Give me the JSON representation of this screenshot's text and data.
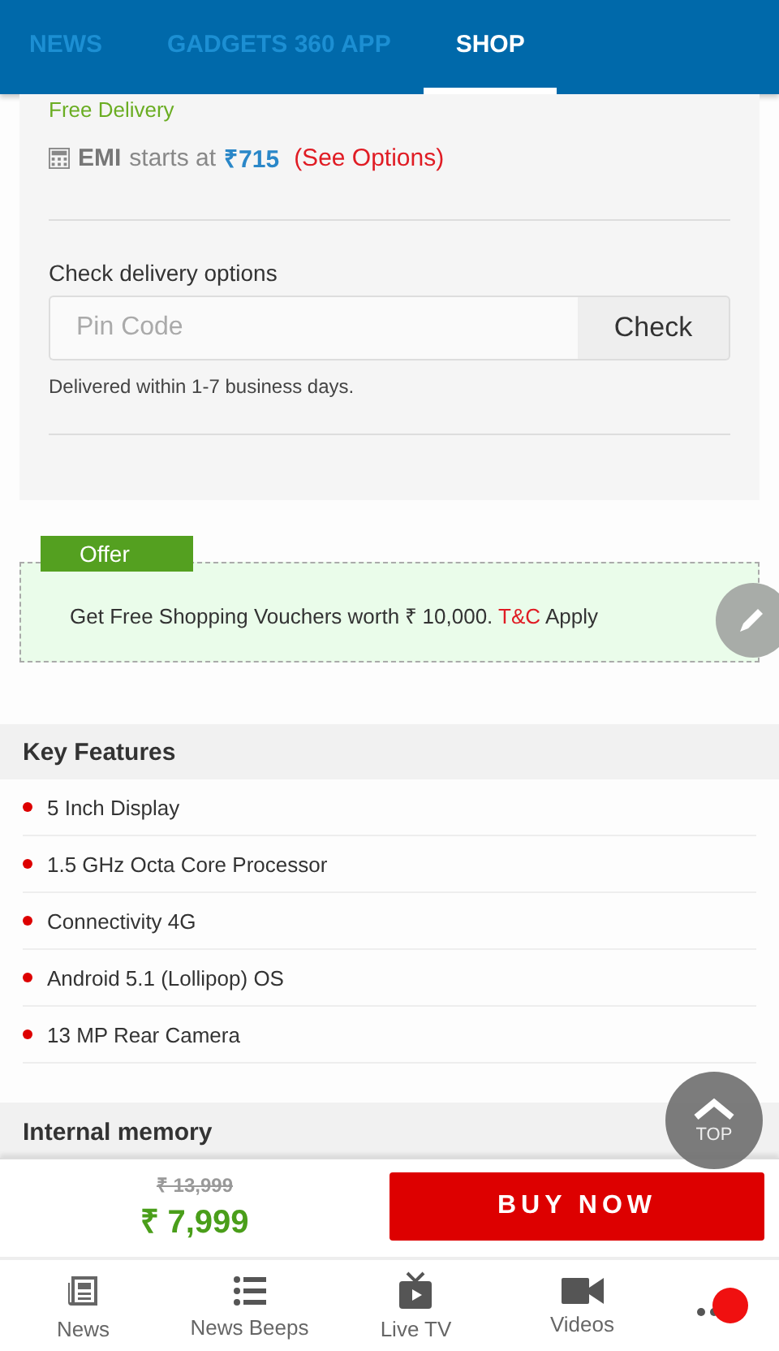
{
  "tabs": [
    {
      "label": "NEWS",
      "selected": false
    },
    {
      "label": "GADGETS 360 APP",
      "selected": false
    },
    {
      "label": "SHOP",
      "selected": true
    }
  ],
  "delivery_note": "Free Delivery",
  "emi": {
    "label": "EMI",
    "text": "starts at",
    "amount": "₹715",
    "link": "(See Options)"
  },
  "delivery_check": {
    "label": "Check delivery options",
    "placeholder": "Pin Code",
    "button": "Check",
    "note": "Delivered within 1-7 business days."
  },
  "offer": {
    "badge": "Offer",
    "text": "Get Free Shopping Vouchers worth ₹ 10,000.",
    "link": "T&C",
    "suffix": "Apply"
  },
  "key_features": {
    "title": "Key Features",
    "items": [
      "5 Inch Display",
      "1.5 GHz Octa Core Processor",
      "Connectivity 4G",
      "Android 5.1 (Lollipop) OS",
      "13 MP Rear Camera"
    ]
  },
  "next_section": "Internal memory",
  "top_button": "TOP",
  "price": {
    "original": "₹ 13,999",
    "current": "₹ 7,999",
    "button": "BUY NOW"
  },
  "bottom_nav": [
    {
      "label": "News",
      "kind": "news"
    },
    {
      "label": "News Beeps",
      "kind": "list"
    },
    {
      "label": "Live TV",
      "kind": "tv"
    },
    {
      "label": "Videos",
      "kind": "video"
    },
    {
      "kind": "more"
    }
  ]
}
